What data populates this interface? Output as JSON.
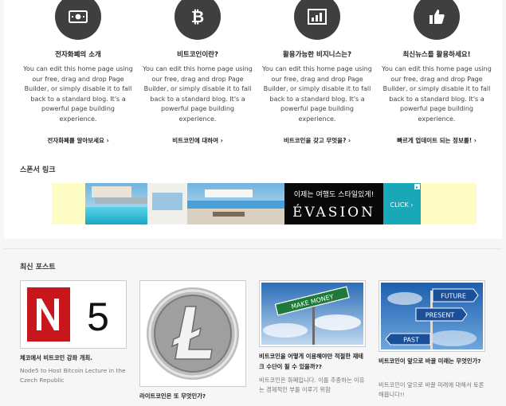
{
  "features": [
    {
      "title": "전자화폐의 소개",
      "desc": "You can edit this home page using our free, drag and drop Page Builder, or simply disable it to fall back to a standard blog. It's a powerful page building experience.",
      "link": "전자화폐를 알아보세요 ›",
      "icon": "banknote-icon"
    },
    {
      "title": "비트코인이란?",
      "desc": "You can edit this home page using our free, drag and drop Page Builder, or simply disable it to fall back to a standard blog. It's a powerful page building experience.",
      "link": "비트코인에 대하여 ›",
      "icon": "bitcoin-icon"
    },
    {
      "title": "활용가능한 비지니스는?",
      "desc": "You can edit this home page using our free, drag and drop Page Builder, or simply disable it to fall back to a standard blog. It's a powerful page building experience.",
      "link": "비트코인을 갖고 무엇을? ›",
      "icon": "bar-chart-icon"
    },
    {
      "title": "최신뉴스를 활용하세요!",
      "desc": "You can edit this home page using our free, drag and drop Page Builder, or simply disable it to fall back to a standard blog. It's a powerful page building experience.",
      "link": "빠르게 업데이트 되는 정보를! ›",
      "icon": "thumbs-up-icon"
    }
  ],
  "sponsor": {
    "title": "스폰서 링크",
    "ad_headline": "이제는 여행도 스타일있게!",
    "ad_brand": "ÉVASION",
    "ad_cta": "CLICK ›"
  },
  "recent": {
    "title": "최신 포스트",
    "posts": [
      {
        "thumb_text": "N5",
        "title": "체코에서 비트코인 강좌 개최.",
        "excerpt": "Node5 to Host Bitcoin Lecture in the Czech Republic"
      },
      {
        "thumb_text": "Ł",
        "title": "라이트코인은 또 무엇인가?",
        "excerpt": ""
      },
      {
        "thumb_text": "MAKE MONEY",
        "title": "비트코인을 어떻게 이용해야만 적절한 재테크 수단이 될 수 있을까??",
        "excerpt": "비트코인은 화폐입니다. 이를 추종하는 이유는 경제적인 부를 이루기 위함"
      },
      {
        "thumb_labels": [
          "FUTURE",
          "PRESENT",
          "PAST"
        ],
        "title": "비트코인이 앞으로 바꿀 미래는 무엇인가?",
        "excerpt": "비트코인이 앞으로 바꿀 미래에 대해서 토론해봅니다!!"
      }
    ]
  },
  "colors": {
    "icon_bg": "#3f3f3f",
    "ad_bg": "#fdfcc5",
    "n5_red": "#c8161d"
  }
}
